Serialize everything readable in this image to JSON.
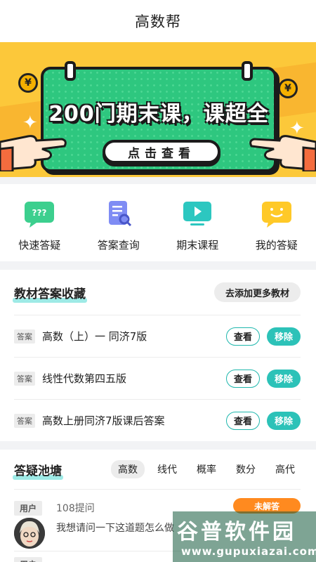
{
  "header": {
    "title": "高数帮"
  },
  "banner": {
    "headline": "200门期末课，课超全",
    "cta_label": "点击查看",
    "coin_symbol": "¥",
    "colors": {
      "background": "#fcc83a",
      "board": "#2ec77f"
    }
  },
  "quick_actions": [
    {
      "label": "快速答疑",
      "icon": "question-bubble-icon",
      "color": "#3ccf8e"
    },
    {
      "label": "答案查询",
      "icon": "document-search-icon",
      "color": "#7f8cf4"
    },
    {
      "label": "期末课程",
      "icon": "video-play-icon",
      "color": "#2cc7c0"
    },
    {
      "label": "我的答疑",
      "icon": "smile-bubble-icon",
      "color": "#ffc928"
    }
  ],
  "textbooks": {
    "title": "教材答案收藏",
    "add_label": "去添加更多教材",
    "tag_label": "答案",
    "view_label": "查看",
    "remove_label": "移除",
    "items": [
      {
        "name": "高数（上）一 同济7版"
      },
      {
        "name": "线性代数第四五版"
      },
      {
        "name": "高数上册同济7版课后答案"
      }
    ]
  },
  "qa": {
    "title": "答疑池塘",
    "tabs": [
      "高数",
      "线代",
      "概率",
      "数分",
      "高代"
    ],
    "active_tab": "高数",
    "posts": [
      {
        "user_tag": "用户",
        "count": "108提问",
        "status": "未解答",
        "question": "我想请问一下这道题怎么做"
      }
    ],
    "next_post_tag": "用户"
  },
  "watermark": {
    "title": "谷普软件园",
    "url": "www.gupuxiazai.com"
  }
}
